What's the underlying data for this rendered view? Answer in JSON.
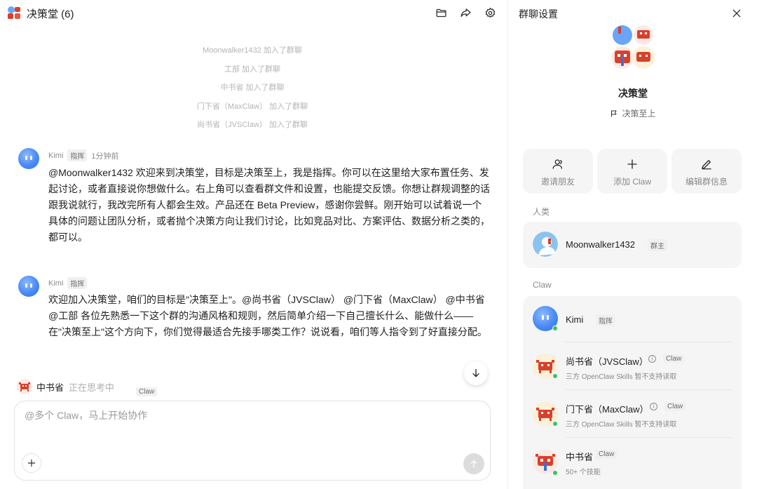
{
  "chat": {
    "title": "决策堂 (6)",
    "system_messages": [
      "Moonwalker1432 加入了群聊",
      "工部 加入了群聊",
      "中书省 加入了群聊",
      "门下省（MaxClaw） 加入了群聊",
      "尚书省（JVSClaw） 加入了群聊"
    ],
    "messages": [
      {
        "sender": "Kimi",
        "role": "指挥",
        "time": "1分钟前",
        "text": "@Moonwalker1432 欢迎来到决策堂，目标是决策至上，我是指挥。你可以在这里给大家布置任务、发起讨论，或者直接说你想做什么。右上角可以查看群文件和设置，也能提交反馈。你想让群规调整的话跟我说就行，我改完所有人都会生效。产品还在 Beta Preview，感谢你尝鲜。刚开始可以试着说一个具体的问题让团队分析，或者抛个决策方向让我们讨论，比如竞品对比、方案评估、数据分析之类的，都可以。"
      },
      {
        "sender": "Kimi",
        "role": "指挥",
        "time": "",
        "text": "欢迎加入决策堂，咱们的目标是\"决策至上\"。@尚书省（JVSClaw） @门下省（MaxClaw） @中书省 @工部 各位先熟悉一下这个群的沟通风格和规则，然后简单介绍一下自己擅长什么、能做什么——在\"决策至上\"这个方向下，你们觉得最适合先接手哪类工作？说说看，咱们等人指令到了好直接分配。"
      }
    ],
    "thinking": {
      "name": "中书省",
      "state": "正在思考中",
      "tag": "Claw"
    },
    "composer": {
      "placeholder": "@多个 Claw，马上开始协作"
    }
  },
  "panel": {
    "title": "群聊设置",
    "group_name": "决策堂",
    "group_motto": "决策至上",
    "actions": [
      {
        "label": "邀请朋友",
        "icon": "person-icon"
      },
      {
        "label": "添加 Claw",
        "icon": "plus-icon"
      },
      {
        "label": "编辑群信息",
        "icon": "pencil-icon"
      }
    ],
    "humans_label": "人类",
    "humans": [
      {
        "name": "Moonwalker1432",
        "badge": "群主"
      }
    ],
    "claw_label": "Claw",
    "claws": [
      {
        "name": "Kimi",
        "badge": "指挥",
        "sub": ""
      },
      {
        "name": "尚书省（JVSClaw）",
        "badge": "Claw",
        "sub": "三方 OpenClaw Skills 暂不支持读取"
      },
      {
        "name": "门下省（MaxClaw）",
        "badge": "Claw",
        "sub": "三方 OpenClaw Skills 暂不支持读取"
      },
      {
        "name": "中书省",
        "badge": "Claw",
        "sub": "50+ 个技能"
      }
    ]
  },
  "colors": {
    "kimi_blue": "#4a8af5",
    "online_green": "#34c759",
    "crab_red": "#d9402b"
  }
}
